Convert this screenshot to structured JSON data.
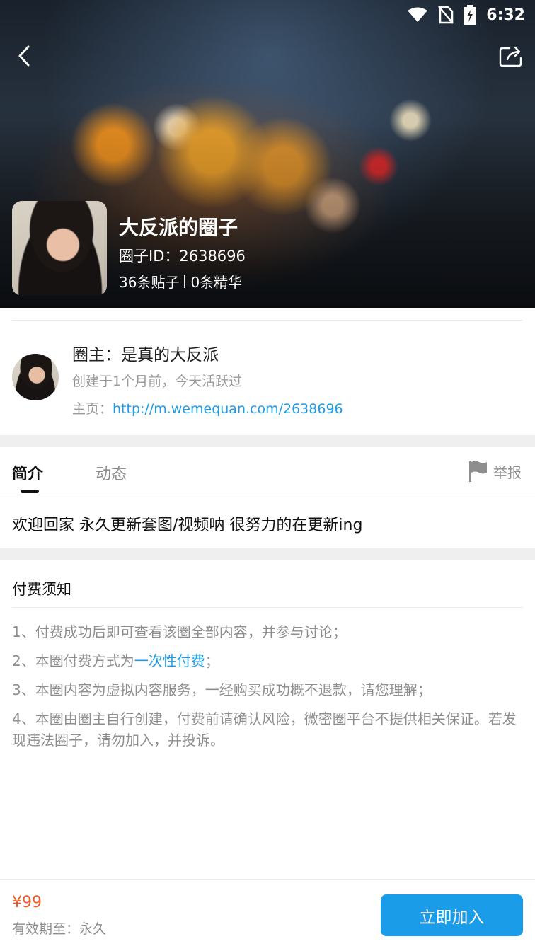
{
  "status_bar": {
    "time": "6:32",
    "icons": [
      "wifi-icon",
      "no-sim-icon",
      "battery-charging-icon"
    ]
  },
  "header": {
    "back_icon": "chevron-left-icon",
    "share_icon": "share-icon"
  },
  "circle": {
    "title": "大反派的圈子",
    "id_text": "圈子ID：2638696",
    "posts": "36条贴子",
    "featured": "0条精华"
  },
  "owner": {
    "name": "圈主：是真的大反派",
    "created": "创建于1个月前，今天活跃过",
    "homepage_label": "主页：",
    "homepage_url": "http://m.wemequan.com/2638696"
  },
  "tabs": [
    {
      "label": "简介",
      "active": true
    },
    {
      "label": "动态",
      "active": false
    }
  ],
  "report": {
    "label": "举报",
    "icon": "flag-icon"
  },
  "intro": "欢迎回家 永久更新套图/视频呐 很努力的在更新ing",
  "notice": {
    "title": "付费须知",
    "item1": "1、付费成功后即可查看该圈全部内容，并参与讨论；",
    "item2_prefix": "2、本圈付费方式为",
    "item2_highlight": "一次性付费",
    "item2_suffix": "；",
    "item3": "3、本圈内容为虚拟内容服务，一经购买成功概不退款，请您理解；",
    "item4": "4、本圈由圈主自行创建，付费前请确认风险，微密圈平台不提供相关保证。若发现违法圈子，请勿加入，并投诉。"
  },
  "footer": {
    "price": "¥99",
    "validity": "有效期至：永久",
    "join_label": "立即加入"
  },
  "colors": {
    "accent": "#1a9ce8",
    "link": "#1c9be6",
    "price": "#f05a28",
    "muted": "#8e8e8e"
  }
}
